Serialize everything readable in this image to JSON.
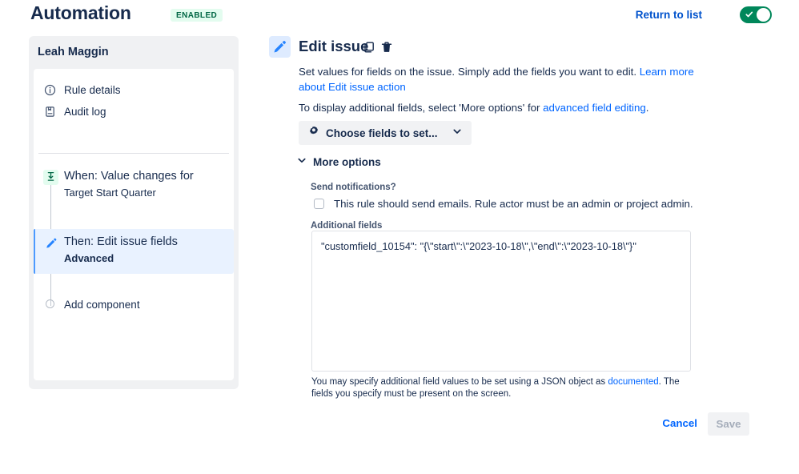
{
  "header": {
    "app_title": "Automation",
    "status_badge": "ENABLED",
    "return_link": "Return to list",
    "toggle_state": "on",
    "toggle_color": "#00875a"
  },
  "sidebar": {
    "title": "Leah Maggin",
    "nav_items": [
      {
        "label": "Rule details",
        "icon": "info-icon"
      },
      {
        "label": "Audit log",
        "icon": "audit-log-icon"
      }
    ],
    "steps": [
      {
        "title": "When: Value changes for",
        "subtitle": "Target Start Quarter",
        "icon": "trigger-import-icon",
        "selected": false
      },
      {
        "title": "Then: Edit issue fields",
        "subtitle": "Advanced",
        "icon": "pencil-icon",
        "selected": true
      }
    ],
    "add_component": "Add component",
    "selected_bg": "#e9f2ff",
    "accent_color": "#4c9aff"
  },
  "main": {
    "title": "Edit issue",
    "title_icon": "pencil-icon",
    "copy_icon": "copy-icon",
    "delete_icon": "trash-icon",
    "description_text": "Set values for fields on the issue. Simply add the fields you want to edit. ",
    "description_link": "Learn more about Edit issue action",
    "description2_prefix": "To display additional fields, select 'More options' for ",
    "description2_link": "advanced field editing",
    "description2_suffix": ".",
    "choose_fields_button": "Choose fields to set...",
    "choose_fields_icon": "gear-icon",
    "choose_fields_chevron": "chevron-down-icon",
    "more_options_label": "More options",
    "more_options_chevron": "chevron-down-icon",
    "send_notifications_label": "Send notifications?",
    "send_notifications_checkbox_label": "This rule should send emails. Rule actor must be an admin or project admin.",
    "send_notifications_checked": false,
    "additional_fields_label": "Additional fields",
    "additional_fields_value": "\"customfield_10154\": \"{\\\"start\\\":\\\"2023-10-18\\\",\\\"end\\\":\\\"2023-10-18\\\"}\"",
    "additional_fields_placeholder": "",
    "help_text_prefix": "You may specify additional field values to be set using a JSON object as ",
    "help_text_link": "documented",
    "help_text_suffix": ". The fields you specify must be present on the screen."
  },
  "footer": {
    "cancel_label": "Cancel",
    "save_label": "Save",
    "save_disabled": true
  }
}
